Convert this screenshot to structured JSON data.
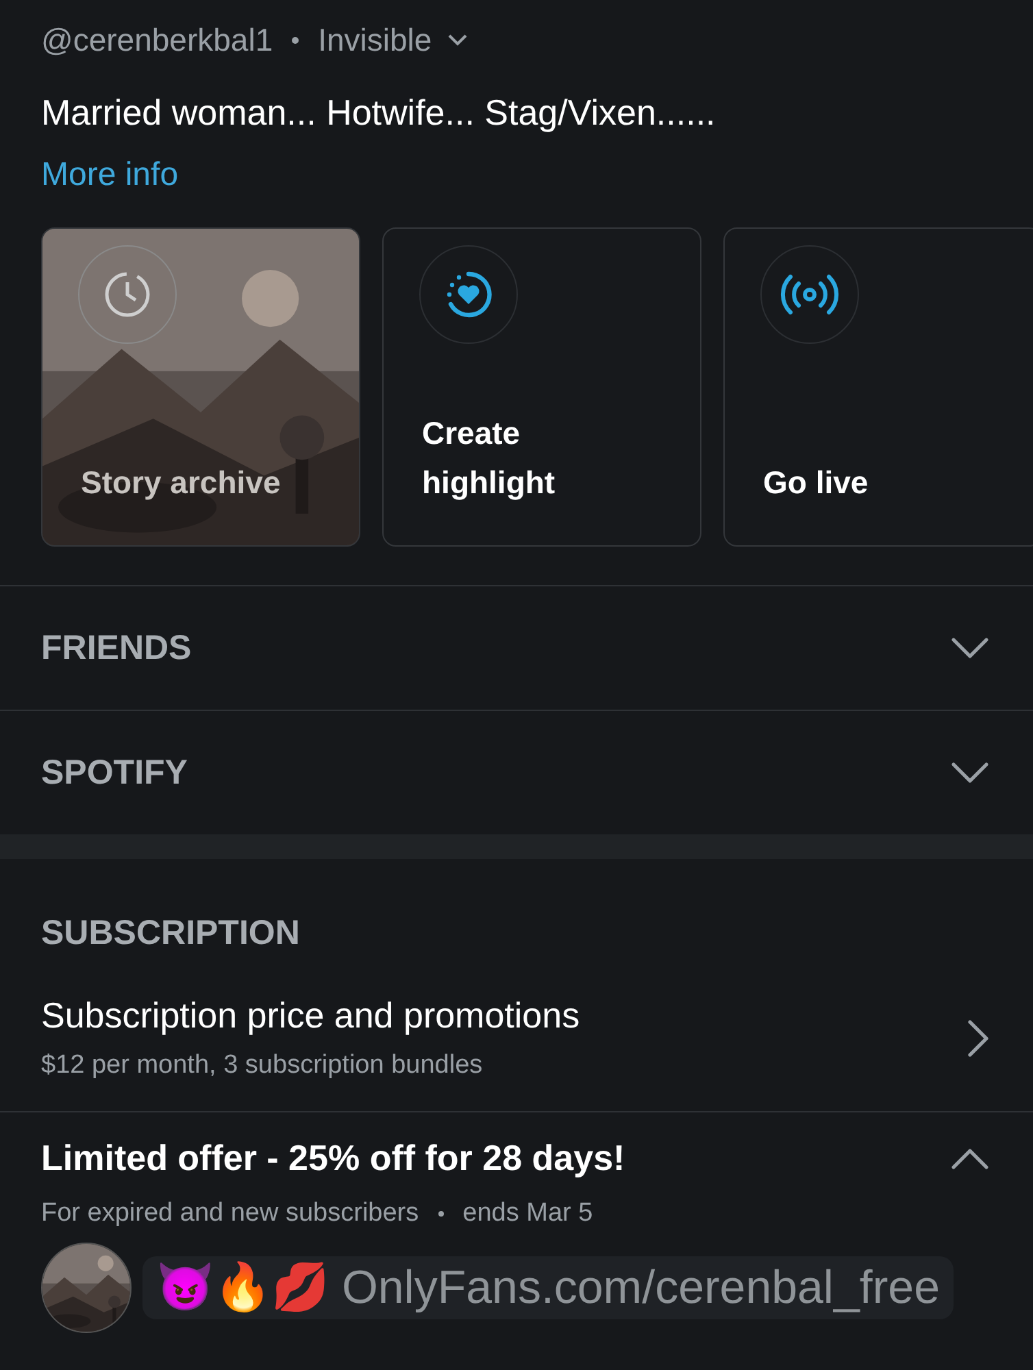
{
  "profile": {
    "handle": "@cerenberkbal1",
    "status": "Invisible",
    "bio": "Married woman... Hotwife... Stag/Vixen......",
    "more_info": "More info"
  },
  "cards": [
    {
      "kind": "archive",
      "label": "Story archive"
    },
    {
      "kind": "highlight",
      "label": "Create highlight"
    },
    {
      "kind": "live",
      "label": "Go live"
    }
  ],
  "sections": [
    {
      "title": "FRIENDS",
      "expanded": false
    },
    {
      "title": "SPOTIFY",
      "expanded": false
    }
  ],
  "subscription": {
    "title": "SUBSCRIPTION",
    "item_title": "Subscription price and promotions",
    "item_subtitle": "$12 per month, 3 subscription bundles"
  },
  "offer": {
    "title": "Limited offer - 25% off for 28 days!",
    "audience": "For expired and new subscribers",
    "ends": "ends Mar 5",
    "expanded": true
  },
  "post": {
    "text": "😈🔥💋 OnlyFans.com/cerenbal_free"
  }
}
